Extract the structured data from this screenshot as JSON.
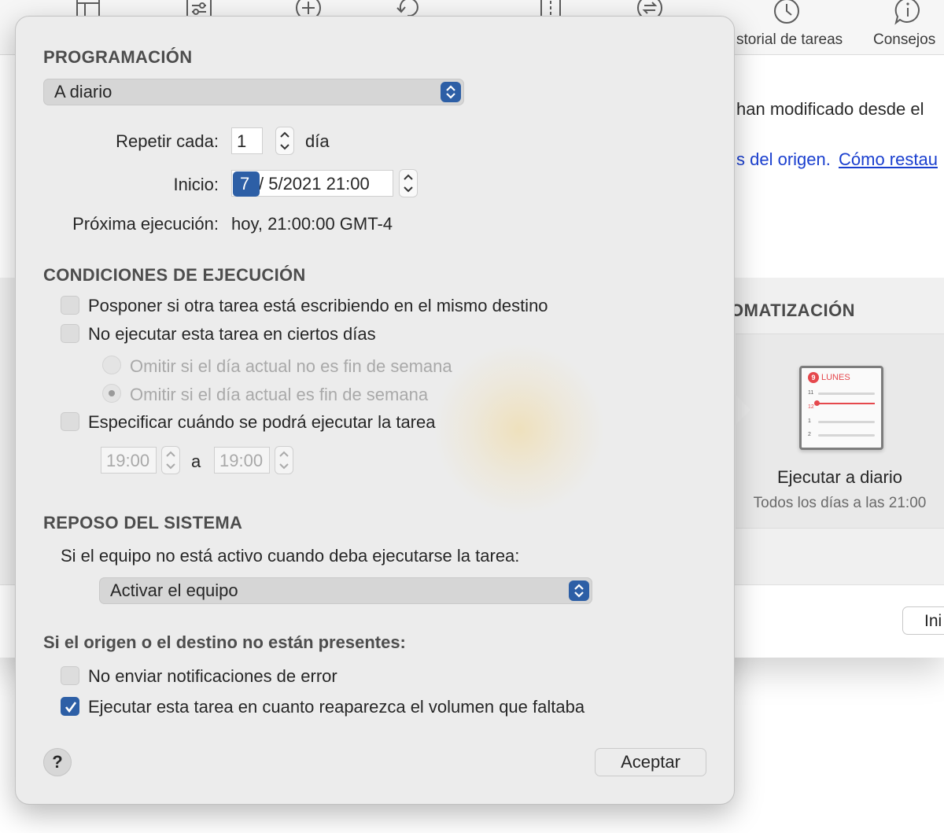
{
  "toolbar": {
    "labels": [
      "storial de tareas",
      "Consejos"
    ],
    "icons": [
      "table-icon",
      "sliders-icon",
      "plus-circle-icon",
      "undo-icon",
      "split-icon",
      "sync-icon",
      "clock-icon",
      "info-bubble-icon"
    ]
  },
  "background": {
    "line1": "han modificado desde el",
    "line2_text": "s del origen.",
    "line2_link": "Cómo restau",
    "section_title": "OMATIZACIÓN",
    "card": {
      "badge": "9",
      "day": "LUNES",
      "hours": [
        "11",
        "12",
        "1",
        "2"
      ],
      "title": "Ejecutar a diario",
      "subtitle": "Todos los días a las 21:00"
    },
    "start_button": "Ini"
  },
  "popover": {
    "programacion": {
      "title": "PROGRAMACIÓN",
      "frequency": "A diario",
      "repeat_label": "Repetir cada:",
      "repeat_value": "1",
      "repeat_unit": "día",
      "start_label": "Inicio:",
      "start_day": "7",
      "start_rest": "/  5/2021 21:00",
      "next_label": "Próxima ejecución:",
      "next_value": "hoy, 21:00:00 GMT-4"
    },
    "condiciones": {
      "title": "CONDICIONES DE EJECUCIÓN",
      "postpone": "Posponer si otra tarea está escribiendo en el mismo destino",
      "skip_days": "No ejecutar esta tarea en ciertos días",
      "skip_not_weekend": "Omitir si el día actual no es fin de semana",
      "skip_weekend": "Omitir si el día actual es fin de semana",
      "specify_time": "Especificar cuándo se podrá ejecutar la tarea",
      "time_from": "19:00",
      "time_sep": "a",
      "time_to": "19:00"
    },
    "reposo": {
      "title": "REPOSO DEL SISTEMA",
      "description": "Si el equipo no está activo cuando deba ejecutarse la tarea:",
      "action": "Activar el equipo"
    },
    "missing": {
      "title": "Si el origen o el destino no están presentes:",
      "no_notify": "No enviar notificaciones de error",
      "run_on_reappear": "Ejecutar esta tarea en cuanto reaparezca el volumen que faltaba",
      "no_notify_checked": false,
      "run_on_reappear_checked": true
    },
    "help": "?",
    "accept": "Aceptar"
  },
  "colors": {
    "accent": "#2d5fa6",
    "link": "#1a3fcf",
    "calendar_red": "#e5484d"
  }
}
